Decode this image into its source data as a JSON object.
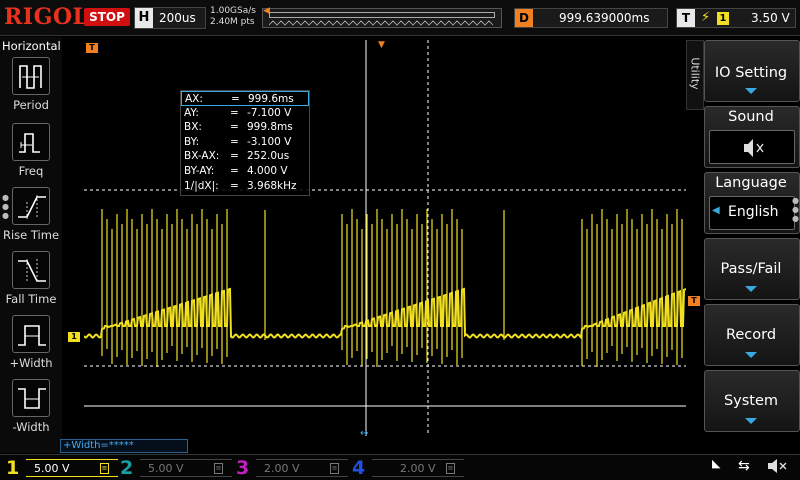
{
  "top": {
    "brand": "RIGOL",
    "run_state": "STOP",
    "horizontal": {
      "label": "H",
      "timebase": "200us"
    },
    "sample_rate": "1.00GSa/s",
    "memory_depth": "2.40M pts",
    "delay": {
      "label": "D",
      "value": "999.639000ms"
    },
    "trigger": {
      "label": "T",
      "edge": "rising-edge-icon",
      "source": "1",
      "level": "3.50 V"
    }
  },
  "left_menu": {
    "title": "Horizontal",
    "items": [
      {
        "label": "Period",
        "icon": "period-icon"
      },
      {
        "label": "Freq",
        "icon": "frequency-icon"
      },
      {
        "label": "Rise Time",
        "icon": "rise-time-icon"
      },
      {
        "label": "Fall Time",
        "icon": "fall-time-icon"
      },
      {
        "label": "+Width",
        "icon": "positive-width-icon"
      },
      {
        "label": "-Width",
        "icon": "negative-width-icon"
      }
    ]
  },
  "cursor_readout": {
    "rows": [
      {
        "key": "AX:",
        "eq": "=",
        "value": "999.6ms"
      },
      {
        "key": "AY:",
        "eq": "=",
        "value": "-7.100 V"
      },
      {
        "key": "BX:",
        "eq": "=",
        "value": "999.8ms"
      },
      {
        "key": "BY:",
        "eq": "=",
        "value": "-3.100 V"
      },
      {
        "key": "BX-AX:",
        "eq": "=",
        "value": "252.0us"
      },
      {
        "key": "BY-AY:",
        "eq": "=",
        "value": "4.000 V"
      },
      {
        "key": "1/|dX|:",
        "eq": "=",
        "value": "3.968kHz"
      }
    ]
  },
  "markers": {
    "trigger_pos": "T",
    "ch1": "1",
    "trigger_level": "T"
  },
  "measure_result": "+Width=*****",
  "right_menu": {
    "tab": "Utility",
    "buttons": [
      {
        "label": "IO Setting"
      },
      {
        "label": "Sound",
        "icon": "speaker-mute-icon"
      },
      {
        "label": "Language",
        "value": "English"
      },
      {
        "label": "Pass/Fail"
      },
      {
        "label": "Record"
      },
      {
        "label": "System"
      }
    ]
  },
  "channels": [
    {
      "num": "1",
      "scale": "5.00 V",
      "color": "#f0e020",
      "active": true
    },
    {
      "num": "2",
      "scale": "5.00 V",
      "color": "#19a0a0",
      "active": false
    },
    {
      "num": "3",
      "scale": "2.00 V",
      "color": "#c020c0",
      "active": false
    },
    {
      "num": "4",
      "scale": "2.00 V",
      "color": "#2050e0",
      "active": false
    }
  ],
  "colors": {
    "ch1": "#f0e020",
    "accent": "#39a9e0",
    "brand": "#e8321e",
    "stop": "#d01010",
    "marker": "#f08020"
  }
}
